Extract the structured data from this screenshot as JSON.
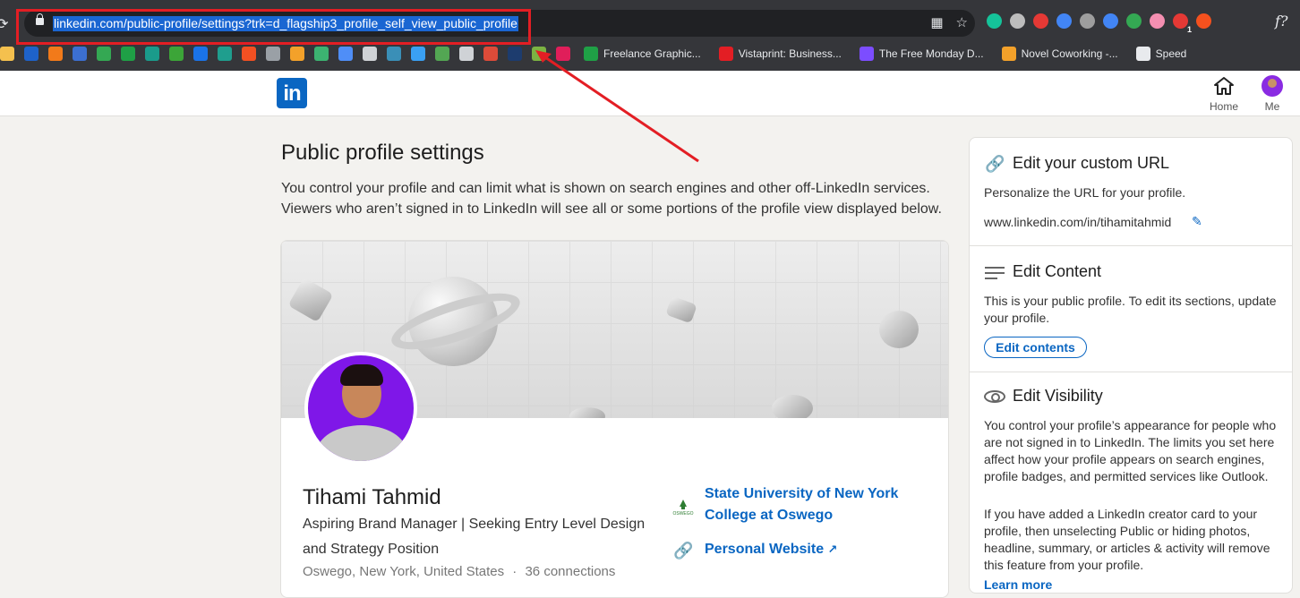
{
  "browser": {
    "url": "linkedin.com/public-profile/settings?trk=d_flagship3_profile_self_view_public_profile",
    "bookmarks": [
      {
        "icon": "bb-icon",
        "color": "#f4c04e"
      },
      {
        "icon": "shield-bookmark-icon",
        "color": "#1e62c9"
      },
      {
        "icon": "orange-circle-icon",
        "color": "#f27a1a"
      },
      {
        "icon": "atlas-icon",
        "color": "#3c6fd1"
      },
      {
        "icon": "google-drive-icon",
        "color": "#34a853"
      },
      {
        "icon": "ck-icon",
        "color": "#1fa046"
      },
      {
        "icon": "drop-icon",
        "color": "#1a9b8b"
      },
      {
        "icon": "leaf-icon",
        "color": "#3ca538"
      },
      {
        "icon": "c-circle-icon",
        "color": "#1a73e8"
      },
      {
        "icon": "k-icon",
        "color": "#1f9e8e"
      },
      {
        "icon": "windows-icon",
        "color": "#f25022"
      },
      {
        "icon": "image-icon",
        "color": "#9aa0a6"
      },
      {
        "icon": "play-icon",
        "color": "#f3a12a"
      },
      {
        "icon": "frog-icon",
        "color": "#3cb371"
      },
      {
        "icon": "slash-icon",
        "color": "#4f8ef7"
      },
      {
        "icon": "globe-icon",
        "color": "#cfd2d6"
      },
      {
        "icon": "bug-icon",
        "color": "#3a8fb7"
      },
      {
        "icon": "cloud-icon",
        "color": "#3aa0f3"
      },
      {
        "icon": "mm-icon",
        "color": "#53a653"
      },
      {
        "icon": "o-circle-icon",
        "color": "#cfd2d6"
      },
      {
        "icon": "g-circle-icon",
        "color": "#dd4b39"
      },
      {
        "icon": "fsa-icon",
        "color": "#1d3c6e"
      },
      {
        "icon": "picture-icon",
        "color": "#7cb342"
      },
      {
        "icon": "slack-icon",
        "color": "#e01e5a"
      }
    ],
    "labeled_bookmarks": [
      {
        "label": "Freelance Graphic...",
        "icon": "pd-icon",
        "color": "#1fa046"
      },
      {
        "label": "Vistaprint: Business...",
        "icon": "vistaprint-icon",
        "color": "#e31e24"
      },
      {
        "label": "The Free Monday D...",
        "icon": "free-monday-icon",
        "color": "#7c4dff"
      },
      {
        "label": "Novel Coworking -...",
        "icon": "novel-icon",
        "color": "#f3a12a"
      },
      {
        "label": "Speed",
        "icon": "speed-icon",
        "color": "#e8eaed"
      }
    ],
    "extension_colors": [
      "#15c39a",
      "#bdbdbd",
      "#e53935",
      "#4285f4",
      "#9e9e9e",
      "#4285f4",
      "#34a853",
      "#f48fb1",
      "#e53935",
      "#f4511e"
    ],
    "extension_badge": "1"
  },
  "nav": {
    "home_label": "Home",
    "me_label": "Me",
    "logo_text": "in"
  },
  "main": {
    "title": "Public profile settings",
    "description": "You control your profile and can limit what is shown on search engines and other off-LinkedIn services. Viewers who aren’t signed in to LinkedIn will see all or some portions of the profile view displayed below."
  },
  "profile": {
    "name": "Tihami Tahmid",
    "headline": "Aspiring Brand Manager | Seeking Entry Level Design and Strategy Position",
    "location": "Oswego, New York, United States",
    "separator": "·",
    "connections": "36 connections",
    "school": "State University of New York College at Oswego",
    "school_logo_text": "OSWEGO",
    "website": "Personal Website"
  },
  "sidebar": {
    "custom_url": {
      "title": "Edit your custom URL",
      "text": "Personalize the URL for your profile.",
      "url": "www.linkedin.com/in/tihamitahmid"
    },
    "content": {
      "title": "Edit Content",
      "text": "This is your public profile. To edit its sections, update your profile.",
      "button": "Edit contents"
    },
    "visibility": {
      "title": "Edit Visibility",
      "text1": "You control your profile’s appearance for people who are not signed in to LinkedIn. The limits you set here affect how your profile appears on search engines, profile badges, and permitted services like Outlook.",
      "text2": "If you have added a LinkedIn creator card to your profile, then unselecting Public or hiding photos, headline, summary, or articles & activity will remove this feature from your profile.",
      "learn_more": "Learn more"
    }
  },
  "annotation_color": "#e31e24"
}
